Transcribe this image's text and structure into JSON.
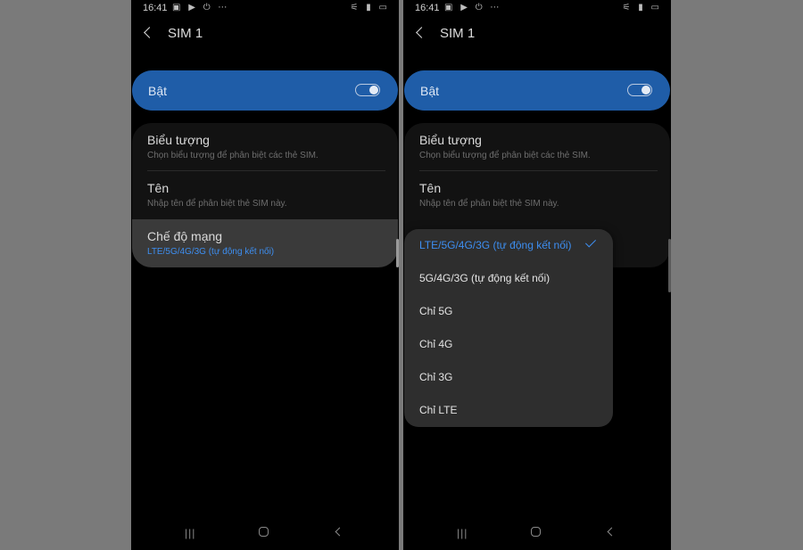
{
  "status_bar": {
    "time": "16:41",
    "icons_left": "▣ ▶ ⏻ ⋯",
    "icons_right": "⚟ ▮ ▭"
  },
  "app_bar": {
    "title": "SIM 1"
  },
  "toggle": {
    "label": "Bật",
    "on": true
  },
  "settings": {
    "icon_title": "Biểu tượng",
    "icon_sub": "Chọn biểu tượng để phân biệt các thẻ SIM.",
    "name_title": "Tên",
    "name_sub": "Nhập tên để phân biệt thẻ SIM này.",
    "network_title": "Chế độ mạng",
    "network_value": "LTE/5G/4G/3G (tự động kết nối)"
  },
  "dropdown": {
    "options": [
      {
        "label": "LTE/5G/4G/3G (tự động kết nối)",
        "selected": true
      },
      {
        "label": "5G/4G/3G (tự động kết nối)",
        "selected": false
      },
      {
        "label": "Chỉ 5G",
        "selected": false
      },
      {
        "label": "Chỉ 4G",
        "selected": false
      },
      {
        "label": "Chỉ 3G",
        "selected": false
      },
      {
        "label": "Chỉ LTE",
        "selected": false
      }
    ]
  },
  "nav": {
    "recents": "|||"
  },
  "colors": {
    "accent": "#3d8ef0",
    "toggle_card": "#1f5da8",
    "background": "#000000"
  }
}
